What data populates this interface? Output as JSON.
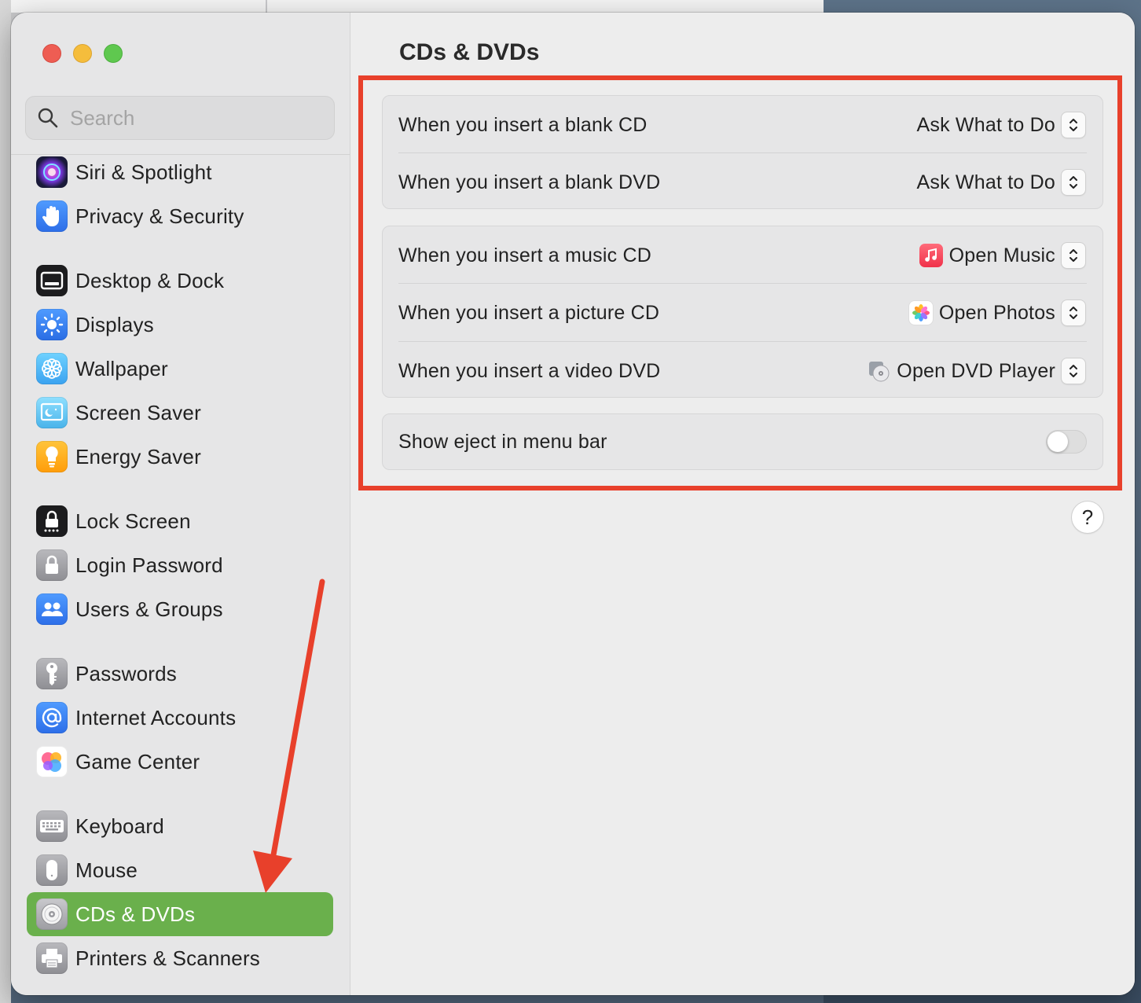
{
  "window": {
    "title": "CDs & DVDs"
  },
  "search": {
    "placeholder": "Search"
  },
  "sidebar": {
    "items": [
      {
        "label": "Siri & Spotlight",
        "icon": "siri-icon"
      },
      {
        "label": "Privacy & Security",
        "icon": "hand-icon"
      },
      {
        "label": "Desktop & Dock",
        "icon": "dock-icon"
      },
      {
        "label": "Displays",
        "icon": "sun-icon"
      },
      {
        "label": "Wallpaper",
        "icon": "flower-icon"
      },
      {
        "label": "Screen Saver",
        "icon": "screensaver-icon"
      },
      {
        "label": "Energy Saver",
        "icon": "lightbulb-icon"
      },
      {
        "label": "Lock Screen",
        "icon": "lock-screen-icon"
      },
      {
        "label": "Login Password",
        "icon": "lock-icon"
      },
      {
        "label": "Users & Groups",
        "icon": "users-icon"
      },
      {
        "label": "Passwords",
        "icon": "key-icon"
      },
      {
        "label": "Internet Accounts",
        "icon": "at-icon"
      },
      {
        "label": "Game Center",
        "icon": "game-center-icon"
      },
      {
        "label": "Keyboard",
        "icon": "keyboard-icon"
      },
      {
        "label": "Mouse",
        "icon": "mouse-icon"
      },
      {
        "label": "CDs & DVDs",
        "icon": "disc-icon",
        "selected": true
      },
      {
        "label": "Printers & Scanners",
        "icon": "printer-icon"
      }
    ]
  },
  "settings": {
    "blank_cd": {
      "label": "When you insert a blank CD",
      "value": "Ask What to Do"
    },
    "blank_dvd": {
      "label": "When you insert a blank DVD",
      "value": "Ask What to Do"
    },
    "music_cd": {
      "label": "When you insert a music CD",
      "value": "Open Music"
    },
    "picture_cd": {
      "label": "When you insert a picture CD",
      "value": "Open Photos"
    },
    "video_dvd": {
      "label": "When you insert a video DVD",
      "value": "Open DVD Player"
    },
    "show_eject": {
      "label": "Show eject in menu bar",
      "enabled": false
    }
  },
  "help": {
    "label": "?"
  },
  "colors": {
    "selected": "#6ab04c",
    "highlight_box": "#e8402b",
    "annotation_arrow": "#e8402b"
  }
}
